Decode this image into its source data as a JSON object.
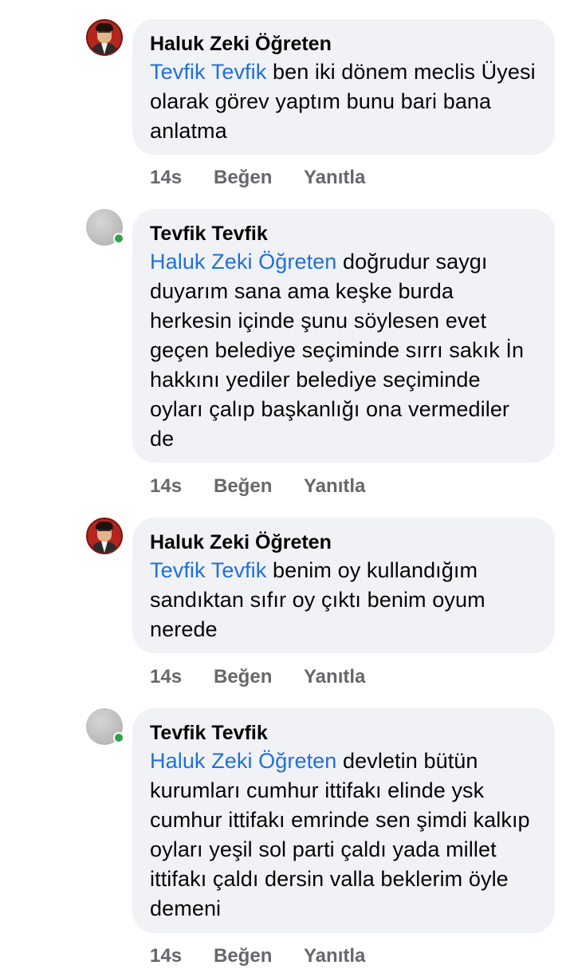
{
  "comments": [
    {
      "author": "Haluk Zeki Öğreten",
      "avatar": "photo-avatar",
      "mention": "Tevfik Tevfik",
      "text": " ben iki dönem meclis Üyesi olarak görev yaptım bunu bari bana anlatma",
      "time": "14s",
      "like_label": "Beğen",
      "reply_label": "Yanıtla"
    },
    {
      "author": "Tevfik Tevfik",
      "avatar": "default-avatar",
      "online": true,
      "mention": "Haluk Zeki Öğreten",
      "text": " doğrudur saygı duyarım sana ama keşke burda herkesin içinde şunu söylesen evet geçen belediye seçiminde sırrı sakık İn hakkını yediler belediye seçiminde oyları çalıp başkanlığı ona vermediler de",
      "time": "14s",
      "like_label": "Beğen",
      "reply_label": "Yanıtla"
    },
    {
      "author": "Haluk Zeki Öğreten",
      "avatar": "photo-avatar",
      "mention": "Tevfik Tevfik",
      "text": " benim oy kullandığım sandıktan sıfır oy çıktı benim oyum nerede",
      "time": "14s",
      "like_label": "Beğen",
      "reply_label": "Yanıtla"
    },
    {
      "author": "Tevfik Tevfik",
      "avatar": "default-avatar",
      "online": true,
      "mention": "Haluk Zeki Öğreten",
      "text": " devletin bütün kurumları cumhur ittifakı elinde ysk cumhur ittifakı emrinde sen şimdi kalkıp oyları yeşil sol parti çaldı yada millet ittifakı çaldı dersin valla beklerim öyle demeni",
      "time": "14s",
      "like_label": "Beğen",
      "reply_label": "Yanıtla"
    }
  ],
  "colors": {
    "bubble": "#f0f2f5",
    "mention": "#216fdb",
    "meta": "#65676b",
    "online": "#31a24c"
  }
}
